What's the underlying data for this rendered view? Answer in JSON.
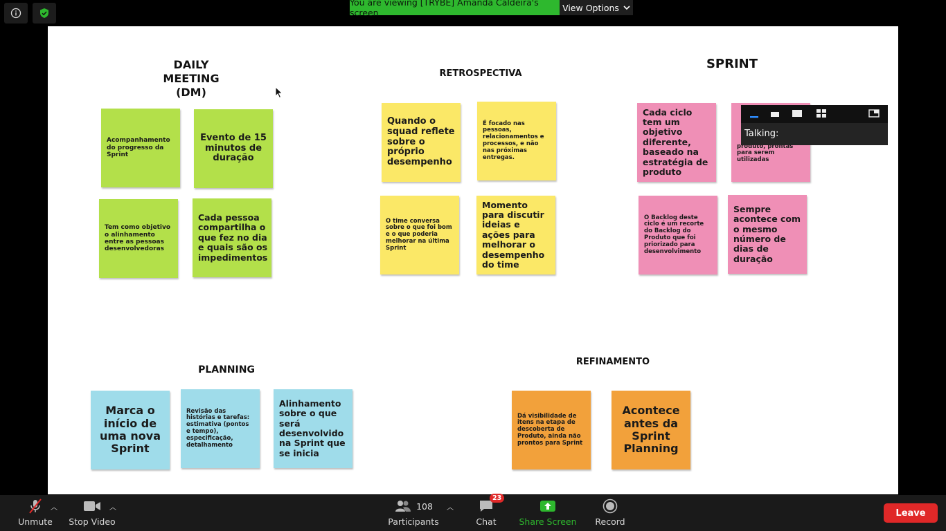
{
  "top": {
    "viewing_banner": "You are viewing [TRYBE] Amanda Caldeira's screen",
    "view_options": "View Options"
  },
  "board": {
    "daily": {
      "title_line1": "DAILY",
      "title_line2": "MEETING",
      "title_line3": "(DM)",
      "notes": [
        "Acompanhamento do progresso da Sprint",
        "Evento de 15 minutos de duração",
        "Tem como objetivo o alinhamento entre as pessoas desenvolvedoras",
        "Cada pessoa compartilha o que fez no dia e quais são os impedimentos"
      ]
    },
    "retro": {
      "title": "RETROSPECTIVA",
      "notes": [
        "Quando o squad reflete sobre o próprio desempenho",
        "É focado nas pessoas, relacionamentos e processos, e não nas próximas entregas.",
        "O time conversa sobre o que foi bom e o que poderia melhorar na última Sprint",
        "Momento para discutir ideias e ações para melhorar o desempenho do time"
      ]
    },
    "sprint": {
      "title": "SPRINT",
      "notes": [
        "Cada ciclo tem um objetivo diferente, baseado na estratégia de produto",
        "produto, prontas para serem utilizadas",
        "O Backlog deste ciclo é um recorte do Backlog do Produto que foi priorizado para desenvolvimento",
        "Sempre acontece com o mesmo número de dias de duração"
      ]
    },
    "planning": {
      "title": "PLANNING",
      "notes": [
        "Marca o início de uma nova Sprint",
        "Revisão das histórias e tarefas: estimativa (pontos e tempo), especificação, detalhamento",
        "Alinhamento sobre o que será desenvolvido na Sprint que se inicia"
      ]
    },
    "refinamento": {
      "title": "REFINAMENTO",
      "notes": [
        "Dá visibilidade de itens na etapa de descoberta de Produto, ainda não prontos para Sprint",
        "Acontece antes da Sprint Planning"
      ]
    }
  },
  "talking_panel": {
    "label": "Talking:"
  },
  "toolbar": {
    "unmute": "Unmute",
    "stop_video": "Stop Video",
    "participants": "Participants",
    "participants_count": "108",
    "chat": "Chat",
    "chat_badge": "23",
    "share_screen": "Share Screen",
    "record": "Record",
    "leave": "Leave"
  },
  "colors": {
    "banner_green": "#2eb82e",
    "leave_red": "#e02828",
    "share_green": "#2eb82e",
    "note_green": "#b3e04a",
    "note_yellow": "#fbe867",
    "note_pink": "#ef8fb6",
    "note_blue": "#9fdcea",
    "note_orange": "#f2a13b"
  }
}
